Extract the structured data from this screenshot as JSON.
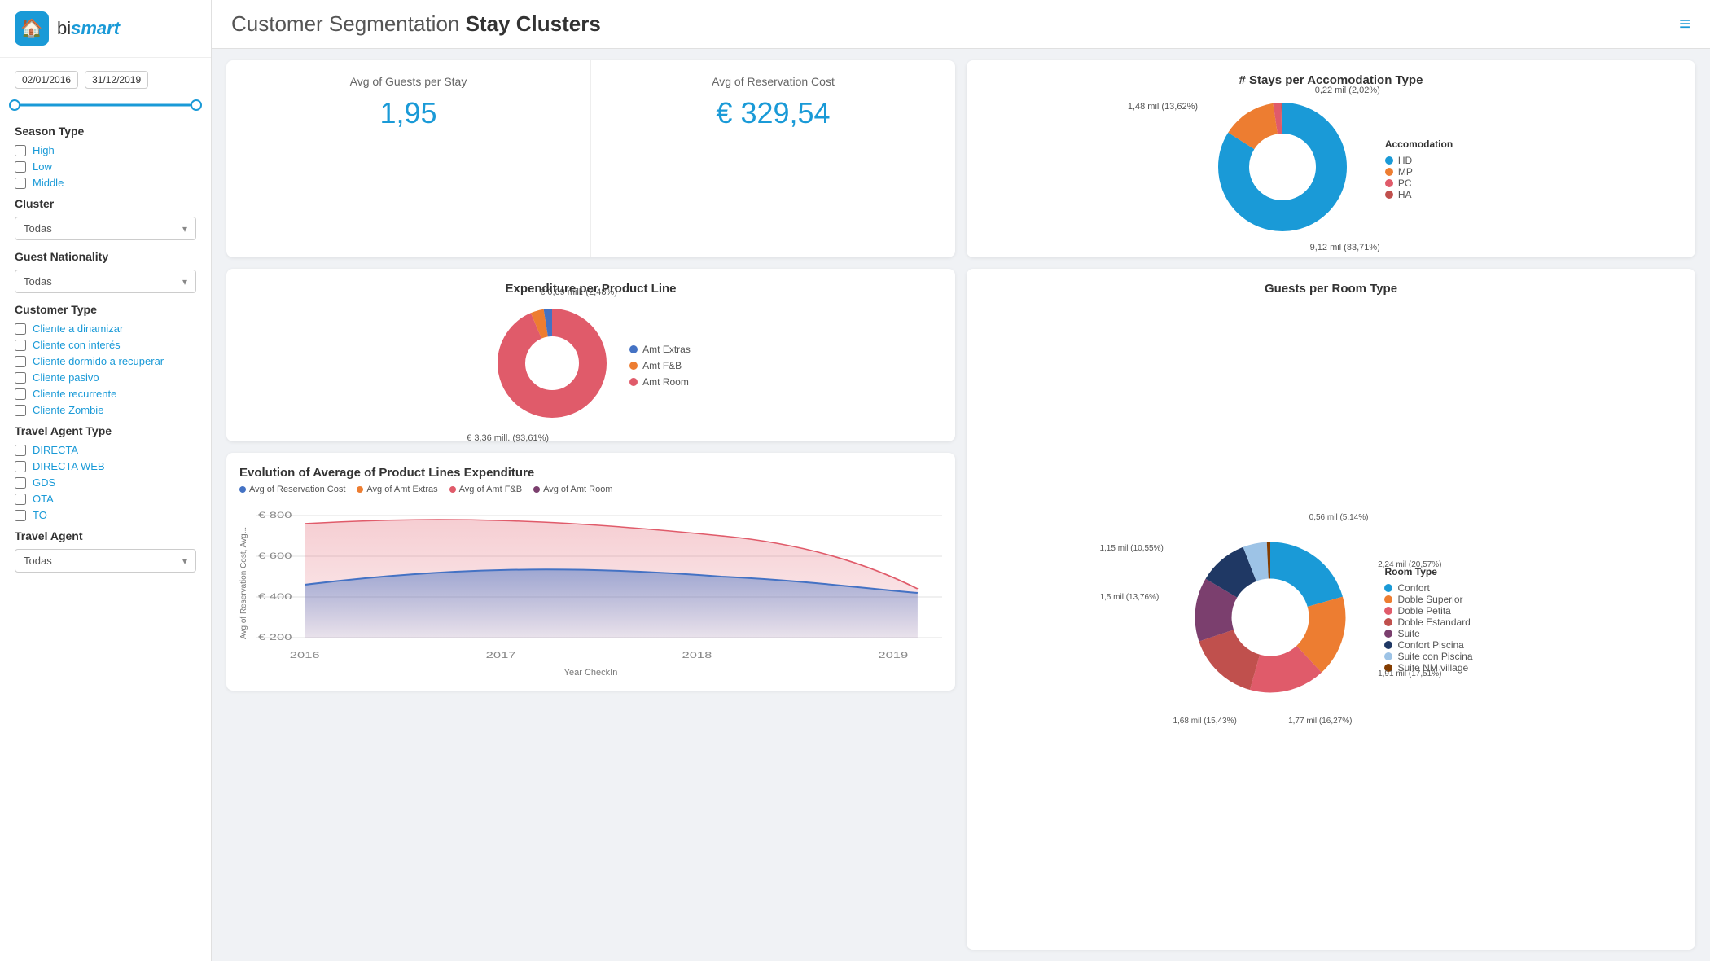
{
  "sidebar": {
    "logo": {
      "house_icon": "🏠",
      "bi_text": "bi",
      "smart_text": "smart"
    },
    "date_start": "02/01/2016",
    "date_end": "31/12/2019",
    "season_type": {
      "title": "Season Type",
      "options": [
        "High",
        "Low",
        "Middle"
      ]
    },
    "cluster": {
      "title": "Cluster",
      "value": "Todas"
    },
    "guest_nationality": {
      "title": "Guest Nationality",
      "value": "Todas"
    },
    "customer_type": {
      "title": "Customer Type",
      "options": [
        "Cliente a dinamizar",
        "Cliente con interés",
        "Cliente dormido a recuperar",
        "Cliente pasivo",
        "Cliente recurrente",
        "Cliente Zombie"
      ]
    },
    "travel_agent_type": {
      "title": "Travel Agent Type",
      "options": [
        "DIRECTA",
        "DIRECTA WEB",
        "GDS",
        "OTA",
        "TO"
      ]
    },
    "travel_agent": {
      "title": "Travel Agent",
      "value": "Todas"
    }
  },
  "header": {
    "title_normal": "Customer Segmentation ",
    "title_bold": "Stay Clusters",
    "hamburger": "≡"
  },
  "kpi": {
    "guests": {
      "label": "Avg of Guests per Stay",
      "value": "1,95"
    },
    "reservation": {
      "label": "Avg of Reservation Cost",
      "value": "€ 329,54"
    }
  },
  "expenditure": {
    "title": "Expenditure per Product Line",
    "labels": {
      "extras": "€ 0,09 mill. (2,48%)",
      "room": "€ 3,36 mill. (93,61%)"
    },
    "legend": [
      {
        "label": "Amt Extras",
        "color": "#4472c4"
      },
      {
        "label": "Amt F&B",
        "color": "#ed7d31"
      },
      {
        "label": "Amt Room",
        "color": "#e05b6a"
      }
    ],
    "segments": [
      {
        "pct": 2.48,
        "color": "#4472c4"
      },
      {
        "pct": 3.91,
        "color": "#ed7d31"
      },
      {
        "pct": 93.61,
        "color": "#e05b6a"
      }
    ]
  },
  "accommodation": {
    "title": "# Stays per Accomodation Type",
    "labels": [
      {
        "text": "0,22 mil (2,02%)",
        "angle": -20
      },
      {
        "text": "1,48 mil (13,62%)",
        "angle": -45
      },
      {
        "text": "9,12 mil (83,71%)",
        "angle": 180
      }
    ],
    "legend": [
      {
        "label": "HD",
        "color": "#1a9ad7"
      },
      {
        "label": "MP",
        "color": "#ed7d31"
      },
      {
        "label": "PC",
        "color": "#e05b6a"
      },
      {
        "label": "HA",
        "color": "#c0504d"
      }
    ],
    "legend_title": "Accomodation",
    "segments": [
      {
        "pct": 83.71,
        "color": "#1a9ad7"
      },
      {
        "pct": 13.62,
        "color": "#ed7d31"
      },
      {
        "pct": 2.02,
        "color": "#e05b6a"
      },
      {
        "pct": 0.65,
        "color": "#c0504d"
      }
    ]
  },
  "evolution": {
    "title": "Evolution of Average of Product Lines Expenditure",
    "legend": [
      {
        "label": "Avg of Reservation Cost",
        "color": "#4472c4"
      },
      {
        "label": "Avg of Amt Extras",
        "color": "#ed7d31"
      },
      {
        "label": "Avg of Amt F&B",
        "color": "#e05b6a"
      },
      {
        "label": "Avg of Amt Room",
        "color": "#7b3f6e"
      }
    ],
    "x_label": "Year CheckIn",
    "y_label": "Avg of Reservation Cost, Avg...",
    "x_ticks": [
      "2016",
      "2017",
      "2018",
      "2019"
    ],
    "y_ticks": [
      "€ 200",
      "€ 400",
      "€ 600",
      "€ 800"
    ]
  },
  "room_type": {
    "title": "Guests per Room Type",
    "labels": [
      {
        "text": "0,56 mil (5,14%)",
        "pos": "top-right"
      },
      {
        "text": "2,24 mil (20,57%)",
        "pos": "right"
      },
      {
        "text": "1,91 mil (17,51%)",
        "pos": "bottom-right"
      },
      {
        "text": "1,77 mil (16,27%)",
        "pos": "bottom"
      },
      {
        "text": "1,68 mil (15,43%)",
        "pos": "bottom-left"
      },
      {
        "text": "1,5 mil (13,76%)",
        "pos": "left"
      },
      {
        "text": "1,15 mil (10,55%)",
        "pos": "top-left"
      }
    ],
    "legend_title": "Room Type",
    "legend": [
      {
        "label": "Confort",
        "color": "#1a9ad7"
      },
      {
        "label": "Doble Superior",
        "color": "#ed7d31"
      },
      {
        "label": "Doble Petita",
        "color": "#e05b6a"
      },
      {
        "label": "Doble Estandard",
        "color": "#c0504d"
      },
      {
        "label": "Suite",
        "color": "#7b3f6e"
      },
      {
        "label": "Confort Piscina",
        "color": "#1f3864"
      },
      {
        "label": "Suite con Piscina",
        "color": "#9dc3e6"
      },
      {
        "label": "Suite NM village",
        "color": "#833c00"
      }
    ],
    "segments": [
      {
        "pct": 20.57,
        "color": "#1a9ad7"
      },
      {
        "pct": 17.51,
        "color": "#ed7d31"
      },
      {
        "pct": 16.27,
        "color": "#e05b6a"
      },
      {
        "pct": 15.43,
        "color": "#c0504d"
      },
      {
        "pct": 13.76,
        "color": "#7b3f6e"
      },
      {
        "pct": 10.55,
        "color": "#1f3864"
      },
      {
        "pct": 5.14,
        "color": "#9dc3e6"
      },
      {
        "pct": 0.77,
        "color": "#833c00"
      }
    ]
  }
}
